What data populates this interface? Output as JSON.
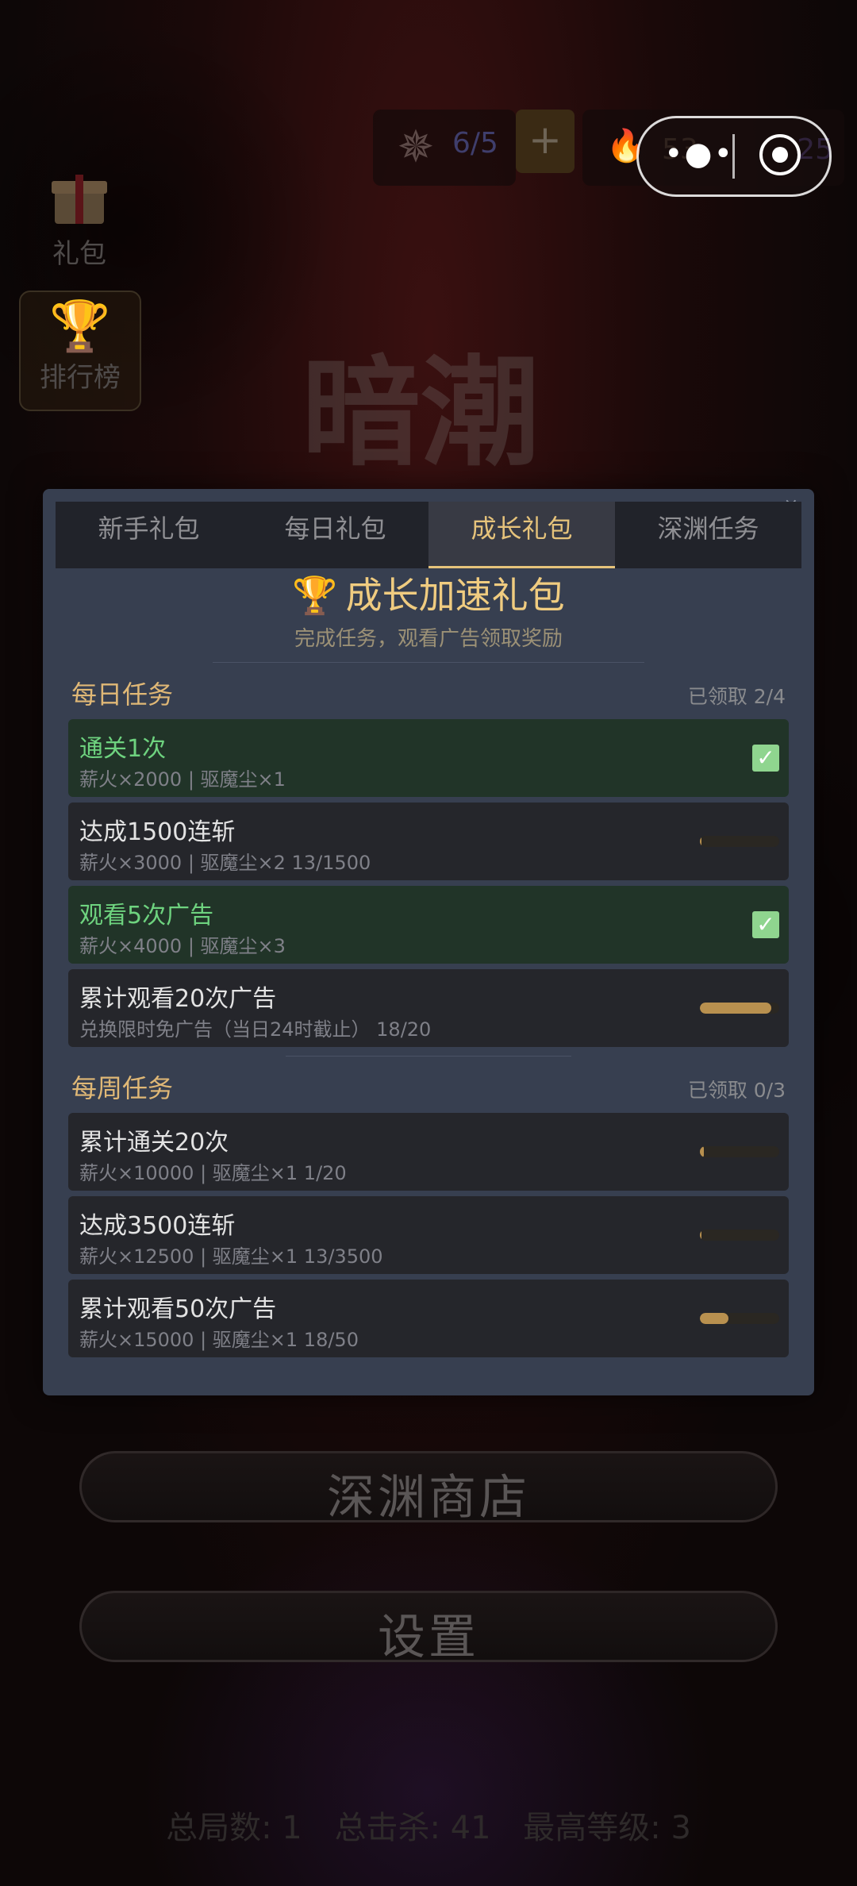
{
  "hud": {
    "energy": "6/5",
    "plus": "+",
    "fire_value": "53",
    "right_value": "25"
  },
  "side": {
    "gift_label": "礼包",
    "rank_label": "排行榜"
  },
  "logo_text": "暗潮",
  "modal": {
    "close": "×",
    "tabs": [
      "新手礼包",
      "每日礼包",
      "成长礼包",
      "深渊任务"
    ],
    "title": "成长加速礼包",
    "subtitle": "完成任务，观看广告领取奖励",
    "daily": {
      "heading": "每日任务",
      "claimed": "已领取 2/4",
      "tasks": [
        {
          "name": "通关1次",
          "desc": "薪火×2000 | 驱魔尘×1",
          "done": true
        },
        {
          "name": "达成1500连斩",
          "desc": "薪火×3000 | 驱魔尘×2  13/1500",
          "done": false,
          "progress": 0.0087
        },
        {
          "name": "观看5次广告",
          "desc": "薪火×4000 | 驱魔尘×3",
          "done": true
        },
        {
          "name": "累计观看20次广告",
          "desc": "兑换限时免广告（当日24时截止）  18/20",
          "done": false,
          "progress": 0.9
        }
      ]
    },
    "weekly": {
      "heading": "每周任务",
      "claimed": "已领取 0/3",
      "tasks": [
        {
          "name": "累计通关20次",
          "desc": "薪火×10000 | 驱魔尘×1  1/20",
          "done": false,
          "progress": 0.05
        },
        {
          "name": "达成3500连斩",
          "desc": "薪火×12500 | 驱魔尘×1  13/3500",
          "done": false,
          "progress": 0.0037
        },
        {
          "name": "累计观看50次广告",
          "desc": "薪火×15000 | 驱魔尘×1  18/50",
          "done": false,
          "progress": 0.36
        }
      ]
    }
  },
  "menu": {
    "shop": "深渊商店",
    "settings": "设置"
  },
  "stats": {
    "games": "总局数: 1",
    "kills": "总击杀: 41",
    "level": "最高等级: 3"
  }
}
